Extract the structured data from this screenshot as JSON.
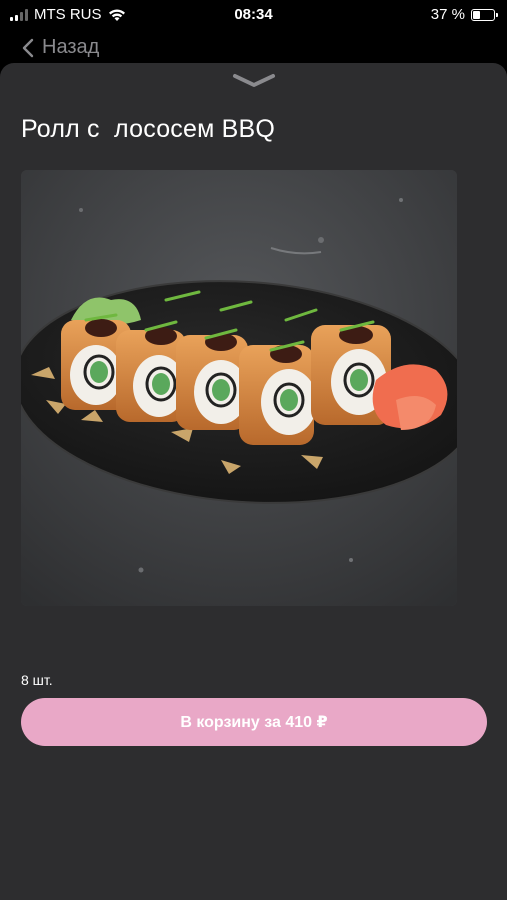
{
  "status_bar": {
    "carrier": "MTS RUS",
    "time": "08:34",
    "battery_percent": "37 %",
    "battery_level": 0.37
  },
  "nav": {
    "back_label": "Назад"
  },
  "product": {
    "title": "Ролл с  лососем BBQ",
    "quantity": "8 шт.",
    "cart_button_label": "В корзину за 410 ₽"
  },
  "colors": {
    "sheet_bg": "#2d2d2f",
    "accent_button": "#e9a8c7",
    "back_text": "#8a8a8e"
  }
}
